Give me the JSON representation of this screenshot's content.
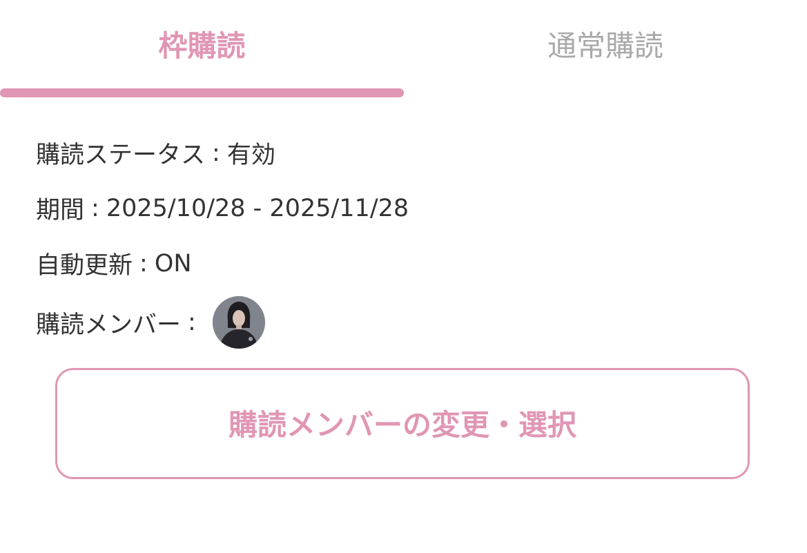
{
  "tabs": [
    {
      "label": "枠購読",
      "active": true
    },
    {
      "label": "通常購読",
      "active": false
    }
  ],
  "status": {
    "label": "購読ステータス",
    "separator": ":",
    "value": "有効"
  },
  "period": {
    "label": "期間",
    "separator": ":",
    "value": "2025/10/28 - 2025/11/28"
  },
  "auto_renew": {
    "label": "自動更新",
    "separator": ":",
    "value": "ON"
  },
  "members": {
    "label": "購読メンバー",
    "separator": ":",
    "avatar_icon": "member-avatar"
  },
  "change_button": {
    "label": "購読メンバーの変更・選択"
  },
  "colors": {
    "accent": "#e096b4",
    "inactive_tab": "#a9a9a9",
    "text": "#333333",
    "background": "#ffffff"
  }
}
